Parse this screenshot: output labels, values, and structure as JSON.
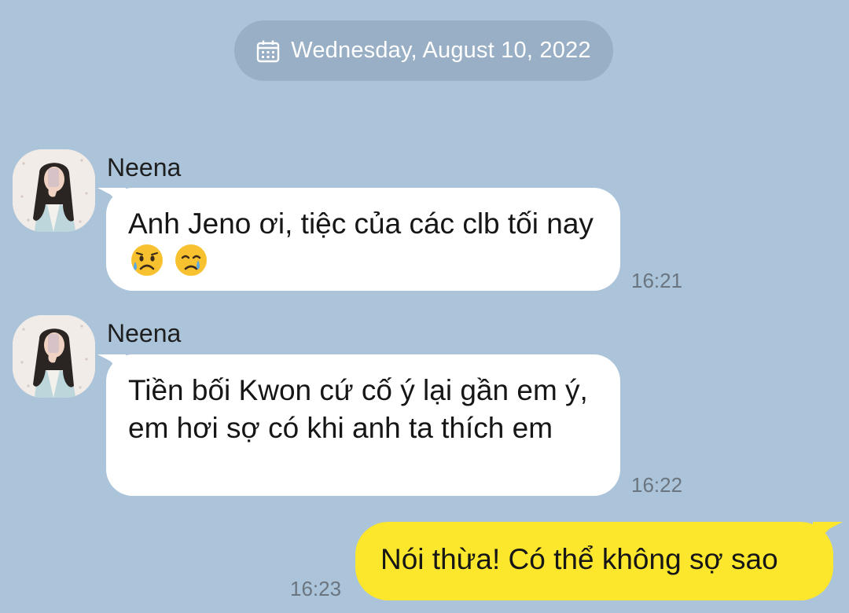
{
  "date_header": {
    "icon": "calendar-icon",
    "text": "Wednesday, August 10, 2022"
  },
  "messages": [
    {
      "sender": "Neena",
      "text": "Anh Jeno ơi, tiệc của các clb tối nay",
      "emojis": [
        "sad-sweat-face-emoji",
        "crying-face-emoji"
      ],
      "time": "16:21"
    },
    {
      "sender": "Neena",
      "text": "Tiền bối Kwon cứ cố ý lại gần em ý, em hơi sợ có khi anh ta thích em",
      "time": "16:22"
    },
    {
      "sender": "",
      "text": "Nói thừa! Có thể không sợ sao",
      "time": "16:23"
    }
  ],
  "colors": {
    "background": "#abc4da",
    "incoming_bubble": "#ffffff",
    "outgoing_bubble": "#fde72c",
    "time_text": "#6a7580"
  }
}
